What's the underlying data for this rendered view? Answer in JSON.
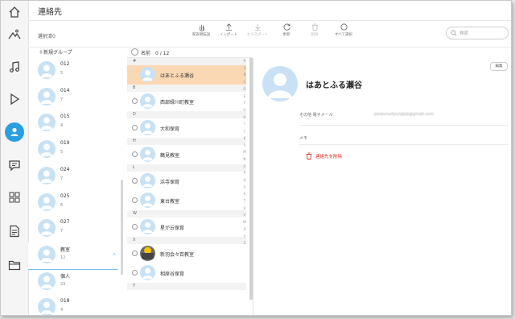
{
  "header": {
    "title": "連絡先",
    "selected": "選択済0"
  },
  "toolbar": [
    {
      "label": "家族間転送",
      "icon": "hand-icon",
      "disabled": false
    },
    {
      "label": "インポート",
      "icon": "upload-icon",
      "disabled": false
    },
    {
      "label": "エクスポート",
      "icon": "download-icon",
      "disabled": true
    },
    {
      "label": "更新",
      "icon": "refresh-icon",
      "disabled": false
    },
    {
      "label": "削除",
      "icon": "trash-icon",
      "disabled": true
    },
    {
      "label": "すべて選択",
      "icon": "circle-icon",
      "disabled": false
    }
  ],
  "search": {
    "placeholder": "検索"
  },
  "groups": {
    "new_label": "新規グループ",
    "items": [
      {
        "name": "012",
        "count": "5"
      },
      {
        "name": "014",
        "count": "7"
      },
      {
        "name": "015",
        "count": "4"
      },
      {
        "name": "019",
        "count": "5"
      },
      {
        "name": "024",
        "count": "7"
      },
      {
        "name": "025",
        "count": "6"
      },
      {
        "name": "027",
        "count": "7"
      },
      {
        "name": "教室",
        "count": "12",
        "selected": true
      },
      {
        "name": "個人",
        "count": "23"
      },
      {
        "name": "018",
        "count": "4"
      }
    ]
  },
  "contacts": {
    "header": "名前　0 / 12",
    "list": [
      {
        "type": "section",
        "label": "#"
      },
      {
        "type": "contact",
        "name": "はあとふる瀬谷",
        "selected": true
      },
      {
        "type": "section",
        "label": "B"
      },
      {
        "type": "contact",
        "name": "西部緑川町教室"
      },
      {
        "type": "section",
        "label": "D"
      },
      {
        "type": "contact",
        "name": "大和保育"
      },
      {
        "type": "section",
        "label": "H"
      },
      {
        "type": "contact",
        "name": "鶴見教室"
      },
      {
        "type": "section",
        "label": "L"
      },
      {
        "type": "contact",
        "name": "浜寺保育"
      },
      {
        "type": "contact",
        "name": "東台教室"
      },
      {
        "type": "section",
        "label": "W"
      },
      {
        "type": "contact",
        "name": "星が丘保育"
      },
      {
        "type": "section",
        "label": "X"
      },
      {
        "type": "contact",
        "name": "新羽会々百教室",
        "photo": true
      },
      {
        "type": "contact",
        "name": "相原谷保育"
      },
      {
        "type": "section",
        "label": "Y"
      }
    ],
    "alphabet": [
      "#",
      "A",
      "B",
      "C",
      "D",
      "E",
      "F",
      "G",
      "H",
      "I",
      "J",
      "K",
      "L",
      "M",
      "N",
      "O",
      "P",
      "Q",
      "R",
      "S",
      "T",
      "U",
      "V",
      "W",
      "X",
      "Y",
      "Z"
    ]
  },
  "detail": {
    "edit_label": "編集",
    "name": "はあとふる瀬谷",
    "field_label": "その他 電子メール",
    "field_value": "pzsavnadyunpjrp@gmail.com",
    "memo_label": "メモ",
    "delete_label": "連絡先を削除"
  },
  "colors": {
    "accent": "#2a9fe0",
    "selected_row": "#fbd8b4",
    "danger": "#e0312a"
  }
}
